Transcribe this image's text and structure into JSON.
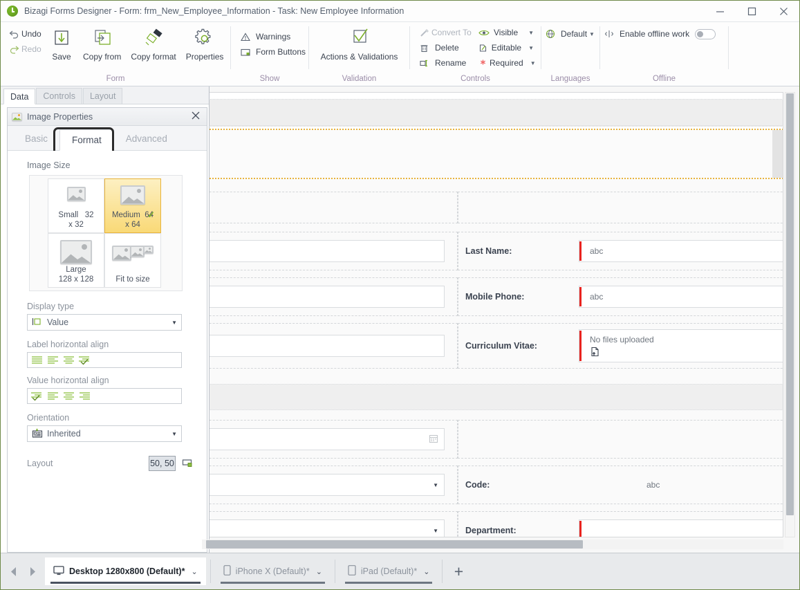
{
  "window": {
    "title": "Bizagi Forms Designer  - Form: frm_New_Employee_Information - Task:  New Employee Information",
    "minimize": "–",
    "maximize": "□",
    "close": "✕"
  },
  "ribbon": {
    "undo": "Undo",
    "redo": "Redo",
    "save": "Save",
    "copy_from": "Copy from",
    "copy_format": "Copy format",
    "properties": "Properties",
    "group_form": "Form",
    "warnings": "Warnings",
    "form_buttons": "Form Buttons",
    "group_show": "Show",
    "actions_validations": "Actions & Validations",
    "group_validation": "Validation",
    "convert_to": "Convert To",
    "delete": "Delete",
    "rename": "Rename",
    "visible": "Visible",
    "editable": "Editable",
    "required": "Required",
    "group_controls": "Controls",
    "default_language": "Default",
    "group_languages": "Languages",
    "enable_offline": "Enable offline work",
    "group_offline": "Offline"
  },
  "panel_tabs": [
    {
      "label": "Data",
      "active": true
    },
    {
      "label": "Controls",
      "active": false
    },
    {
      "label": "Layout",
      "active": false
    }
  ],
  "properties": {
    "title": "Image Properties",
    "close": "✕",
    "tabs": [
      {
        "label": "Basic",
        "active": false,
        "focused": false
      },
      {
        "label": "Format",
        "active": true,
        "focused": true
      },
      {
        "label": "Advanced",
        "active": false,
        "focused": false
      }
    ],
    "image_size": {
      "label": "Image Size",
      "options": [
        {
          "name": "Small",
          "size": "32",
          "line2": "x 32",
          "selected": false
        },
        {
          "name": "Medium",
          "size": "64",
          "line2": "x 64",
          "selected": true
        },
        {
          "name": "Large",
          "size": "",
          "line2": "128 x 128",
          "selected": false
        },
        {
          "name": "Fit to size",
          "size": "",
          "line2": "",
          "selected": false
        }
      ]
    },
    "display_type": {
      "label": "Display type",
      "value": "Value"
    },
    "label_align": {
      "label": "Label horizontal align",
      "selected_index": 3
    },
    "value_align": {
      "label": "Value horizontal align",
      "selected_index": 0
    },
    "orientation": {
      "label": "Orientation",
      "value": "Inherited"
    },
    "layout": {
      "label": "Layout",
      "value": "50, 50"
    }
  },
  "form": {
    "rows": [
      {
        "label": "Last Name:",
        "value": "abc",
        "type": "text",
        "required": true
      },
      {
        "label": "Mobile Phone:",
        "value": "abc",
        "type": "text",
        "required": true
      },
      {
        "label": "Curriculum Vitae:",
        "value": "No files uploaded",
        "type": "file",
        "required": true
      },
      {
        "label": "Code:",
        "value": "abc",
        "type": "plain",
        "required": false
      },
      {
        "label": "Department:",
        "value": "",
        "type": "dropdown",
        "required": true
      }
    ]
  },
  "devices": {
    "tabs": [
      {
        "label": "Desktop 1280x800 (Default)",
        "modified": "*",
        "icon": "monitor-icon",
        "active": true
      },
      {
        "label": "iPhone X (Default)",
        "modified": "*",
        "icon": "phone-icon",
        "active": false
      },
      {
        "label": "iPad (Default)",
        "modified": "*",
        "icon": "tablet-icon",
        "active": false
      }
    ],
    "add": "+",
    "prev": "◀",
    "next": "▶"
  },
  "colors": {
    "accent_green": "#7cb02b",
    "selection_amber": "#e8b33c",
    "required_red": "#e8231f",
    "group_label": "#9b8da8"
  }
}
